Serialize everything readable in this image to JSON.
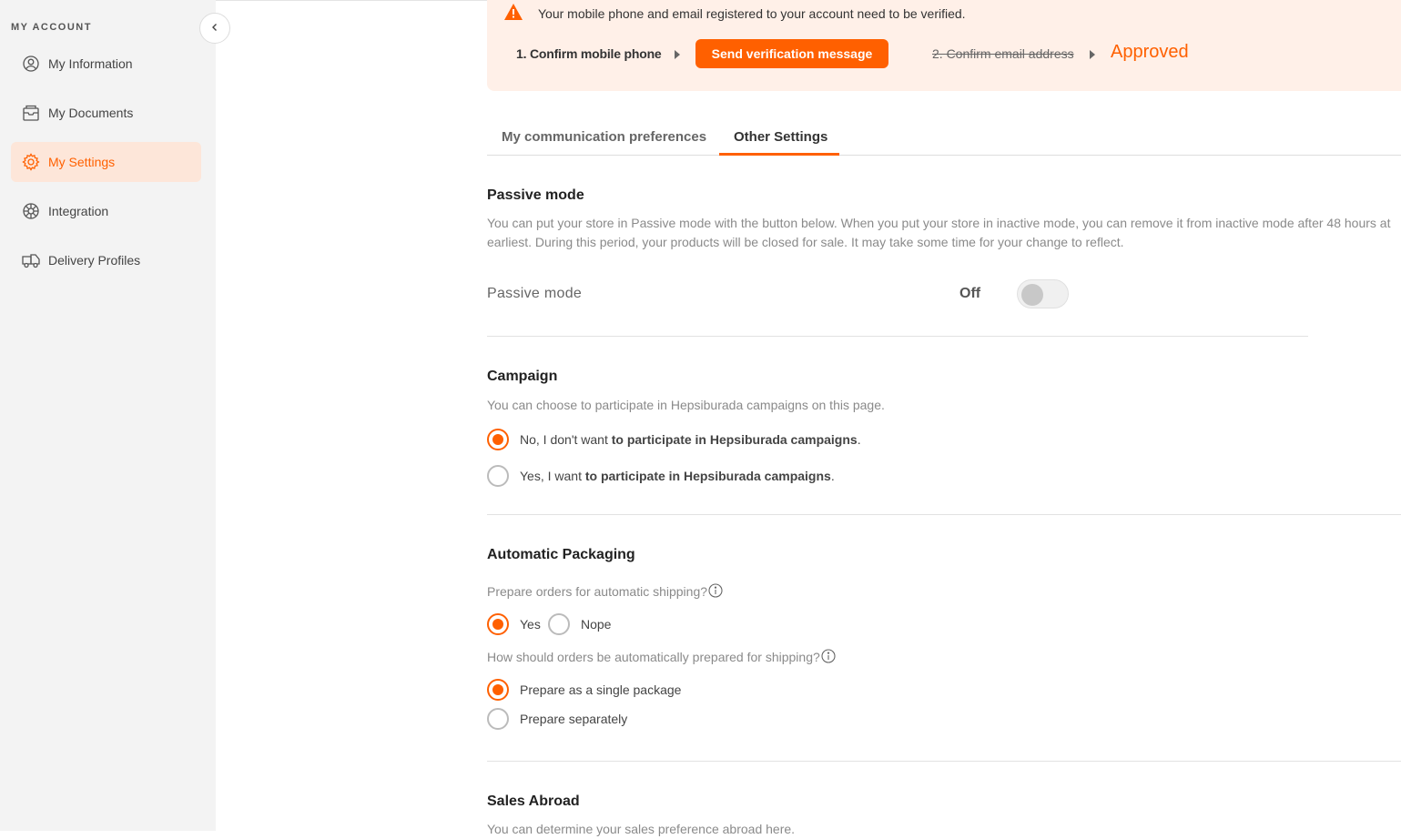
{
  "sidebar": {
    "title": "MY ACCOUNT",
    "items": [
      {
        "label": "My Information",
        "icon": "user-circle-icon"
      },
      {
        "label": "My Documents",
        "icon": "documents-icon"
      },
      {
        "label": "My Settings",
        "icon": "gear-icon",
        "active": true
      },
      {
        "label": "Integration",
        "icon": "integration-icon"
      },
      {
        "label": "Delivery Profiles",
        "icon": "truck-icon"
      }
    ]
  },
  "banner": {
    "message": "Your mobile phone and email registered to your account need to be verified.",
    "step1": "1. Confirm mobile phone",
    "send_button": "Send verification message",
    "step2": "2. Confirm email address",
    "status": "Approved"
  },
  "tabs": [
    {
      "label": "My communication preferences"
    },
    {
      "label": "Other Settings",
      "active": true
    }
  ],
  "passive_mode": {
    "title": "Passive mode",
    "description_line1": "You can put your store in Passive mode with the button below. When you put your store in inactive mode, you can remove it from inactive mode after 48 hours at",
    "description_line2": "earliest. During this period, your products will be closed for sale. It may take some time for your change to reflect.",
    "row_label": "Passive mode",
    "toggle_state": "Off"
  },
  "campaign": {
    "title": "Campaign",
    "description": "You can choose to participate in Hepsiburada campaigns on this page.",
    "option_no_prefix": "No, I don't want ",
    "option_no_bold": "to participate in Hepsiburada campaigns",
    "option_yes_prefix": "Yes, I want ",
    "option_yes_bold": "to participate in Hepsiburada campaigns",
    "period": "."
  },
  "packaging": {
    "title": "Automatic Packaging",
    "question1": "Prepare orders for automatic shipping?",
    "yes": "Yes",
    "nope": "Nope",
    "question2": "How should orders be automatically prepared for shipping?",
    "single": "Prepare as a single package",
    "separate": "Prepare separately"
  },
  "sales_abroad": {
    "title": "Sales Abroad",
    "description": "You can determine your sales preference abroad here."
  },
  "colors": {
    "accent": "#ff6000",
    "banner_bg": "#fff0e8",
    "active_nav_bg": "#fde6d9"
  }
}
